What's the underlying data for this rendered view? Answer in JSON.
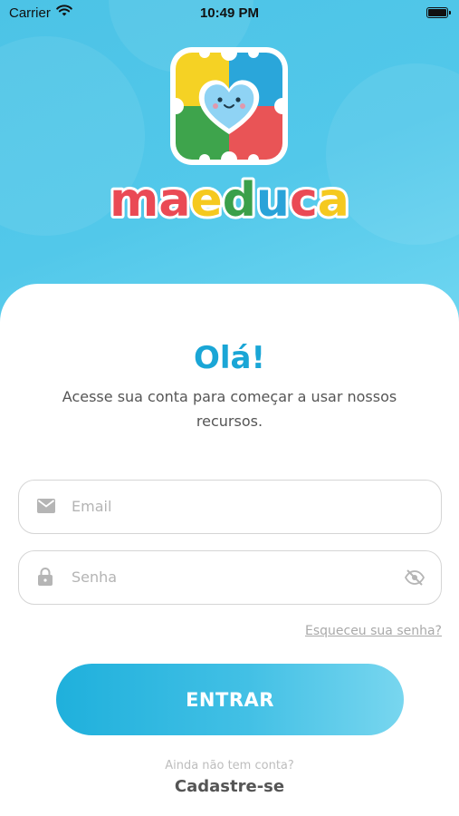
{
  "status_bar": {
    "carrier": "Carrier",
    "time": "10:49 PM"
  },
  "brand": {
    "wordmark": "maeduca",
    "letter_colors": [
      "#ea4a55",
      "#ea4a55",
      "#f5c91f",
      "#3aa04a",
      "#29a3d9",
      "#ea4a55",
      "#f5c91f"
    ],
    "icon_colors": {
      "yellow": "#f5d224",
      "blue": "#2aa6da",
      "green": "#3ea44c",
      "red": "#e95456",
      "heart": "#8fd3f4"
    }
  },
  "login": {
    "greeting": "Olá!",
    "subtitle": "Acesse sua conta para começar a usar nossos recursos.",
    "email_placeholder": "Email",
    "password_placeholder": "Senha",
    "forgot_password": "Esqueceu sua senha?",
    "submit_label": "ENTRAR",
    "no_account_text": "Ainda não tem conta?",
    "signup_label": "Cadastre-se"
  },
  "colors": {
    "accent": "#1aa6d6",
    "hero_bg": "#52c8ea"
  }
}
